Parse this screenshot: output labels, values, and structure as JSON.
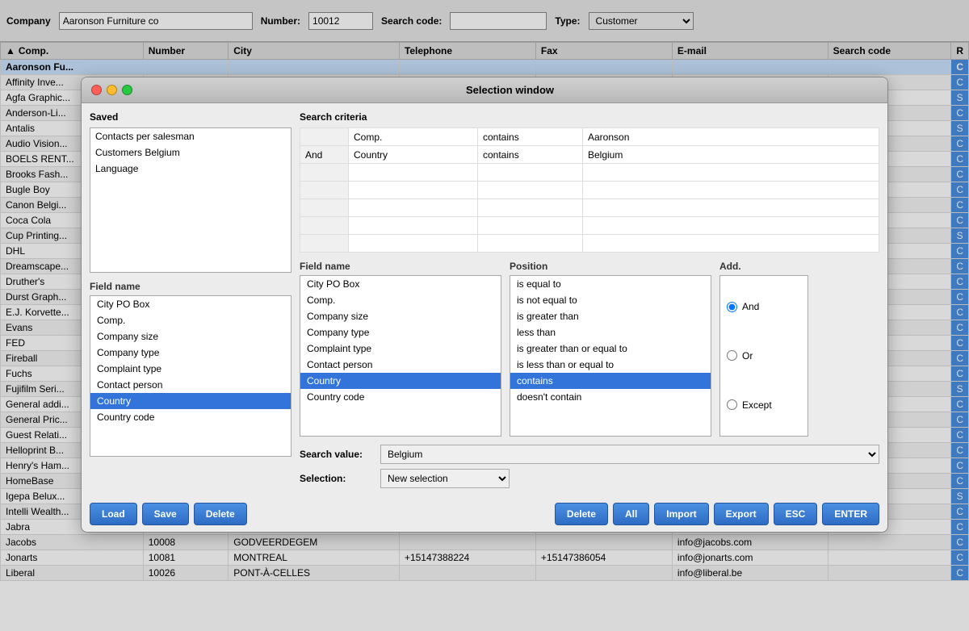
{
  "topbar": {
    "company_label": "Company",
    "company_value": "Aaronson Furniture co",
    "number_label": "Number:",
    "number_value": "10012",
    "search_code_label": "Search code:",
    "search_code_value": "",
    "type_label": "Type:",
    "type_value": "Customer"
  },
  "table": {
    "columns": [
      "Comp.",
      "Number",
      "City",
      "Telephone",
      "Fax",
      "E-mail",
      "Search code",
      "R"
    ],
    "rows": [
      [
        "Aaronson Fu...",
        "",
        "",
        "",
        "",
        "",
        "",
        "C"
      ],
      [
        "Affinity Inve...",
        "",
        "",
        "",
        "",
        "",
        "",
        "C"
      ],
      [
        "Agfa Graphic...",
        "",
        "",
        "",
        "",
        "",
        "",
        "S"
      ],
      [
        "Anderson-Li...",
        "",
        "",
        "",
        "",
        "",
        "",
        "C"
      ],
      [
        "Antalis",
        "",
        "",
        "",
        "",
        "",
        "",
        "S"
      ],
      [
        "Audio Vision...",
        "",
        "",
        "",
        "",
        "",
        "",
        "C"
      ],
      [
        "BOELS RENT...",
        "",
        "",
        "",
        "",
        "",
        "",
        "C"
      ],
      [
        "Brooks Fash...",
        "",
        "",
        "",
        "",
        "",
        "",
        "C"
      ],
      [
        "Bugle Boy",
        "",
        "",
        "",
        "",
        "",
        "",
        "C"
      ],
      [
        "Canon Belgi...",
        "",
        "",
        "",
        "",
        "",
        "",
        "C"
      ],
      [
        "Coca Cola",
        "",
        "",
        "",
        "",
        "",
        "",
        "C"
      ],
      [
        "Cup Printing...",
        "",
        "",
        "",
        "",
        "",
        "",
        "S"
      ],
      [
        "DHL",
        "",
        "",
        "",
        "",
        "",
        "",
        "C"
      ],
      [
        "Dreamscape...",
        "",
        "",
        "",
        "",
        "",
        "",
        "C"
      ],
      [
        "Druther's",
        "",
        "",
        "",
        "",
        "",
        "",
        "C"
      ],
      [
        "Durst Graph...",
        "",
        "",
        "",
        "",
        "",
        "",
        "C"
      ],
      [
        "E.J. Korvette...",
        "",
        "",
        "",
        "",
        "",
        "",
        "C"
      ],
      [
        "Evans",
        "",
        "",
        "",
        "",
        "",
        "",
        "C"
      ],
      [
        "FED",
        "",
        "",
        "",
        "",
        "",
        "",
        "C"
      ],
      [
        "Fireball",
        "",
        "",
        "",
        "",
        "",
        "",
        "C"
      ],
      [
        "Fuchs",
        "",
        "",
        "",
        "",
        "",
        "",
        "C"
      ],
      [
        "Fujifilm Seri...",
        "",
        "",
        "",
        "",
        "",
        "",
        "S"
      ],
      [
        "General addi...",
        "",
        "",
        "",
        "",
        "",
        "",
        "C"
      ],
      [
        "General Pric...",
        "",
        "",
        "",
        "",
        "",
        "",
        "C"
      ],
      [
        "Guest Relati...",
        "",
        "",
        "",
        "",
        "",
        "",
        "C"
      ],
      [
        "Helloprint B...",
        "",
        "",
        "",
        "",
        "",
        "",
        "C"
      ],
      [
        "Henry's Ham...",
        "",
        "",
        "",
        "",
        "",
        "",
        "C"
      ],
      [
        "HomeBase",
        "",
        "",
        "",
        "",
        "",
        "",
        "C"
      ],
      [
        "Igepa Belux...",
        "",
        "",
        "",
        "",
        "",
        "",
        "S"
      ],
      [
        "Intelli Wealth...",
        "",
        "",
        "",
        "",
        "",
        "",
        "C"
      ],
      [
        "Jabra",
        "",
        "",
        "",
        "",
        "",
        "",
        "C"
      ],
      [
        "Jacobs",
        "10008",
        "GODVEERDEGEM",
        "",
        "",
        "info@jacobs.com",
        "",
        "C"
      ],
      [
        "Jonarts",
        "10081",
        "MONTREAL",
        "+15147388224",
        "+15147386054",
        "info@jonarts.com",
        "",
        "C"
      ],
      [
        "Liberal",
        "10026",
        "PONT-À-CELLES",
        "",
        "",
        "info@liberal.be",
        "",
        "C"
      ]
    ]
  },
  "modal": {
    "title": "Selection window",
    "saved_label": "Saved",
    "saved_items": [
      "Contacts per salesman",
      "Customers Belgium",
      "Language"
    ],
    "criteria_label": "Search criteria",
    "criteria_rows": [
      {
        "connector": "",
        "field": "Comp.",
        "position": "contains",
        "value": "Aaronson"
      },
      {
        "connector": "And",
        "field": "Country",
        "position": "contains",
        "value": "Belgium"
      },
      {
        "connector": "",
        "field": "",
        "position": "",
        "value": ""
      },
      {
        "connector": "",
        "field": "",
        "position": "",
        "value": ""
      },
      {
        "connector": "",
        "field": "",
        "position": "",
        "value": ""
      },
      {
        "connector": "",
        "field": "",
        "position": "",
        "value": ""
      },
      {
        "connector": "",
        "field": "",
        "position": "",
        "value": ""
      }
    ],
    "field_name_label": "Field name",
    "field_items": [
      "City PO Box",
      "Comp.",
      "Company size",
      "Company type",
      "Complaint type",
      "Contact person",
      "Country",
      "Country code"
    ],
    "field_selected": "Country",
    "position_label": "Position",
    "position_items": [
      "is equal to",
      "is not equal to",
      "is greater than",
      "less than",
      "is greater than or equal to",
      "is less than or equal to",
      "contains",
      "doesn't contain"
    ],
    "position_selected": "contains",
    "add_label": "Add.",
    "add_options": [
      "And",
      "Or",
      "Except"
    ],
    "add_selected": "And",
    "search_value_label": "Search value:",
    "search_value": "Belgium",
    "selection_label": "Selection:",
    "selection_value": "New selection",
    "selection_options": [
      "New selection"
    ],
    "buttons_left": [
      "Load",
      "Save",
      "Delete"
    ],
    "buttons_right": [
      "Delete",
      "All",
      "Import",
      "Export",
      "ESC",
      "ENTER"
    ]
  }
}
